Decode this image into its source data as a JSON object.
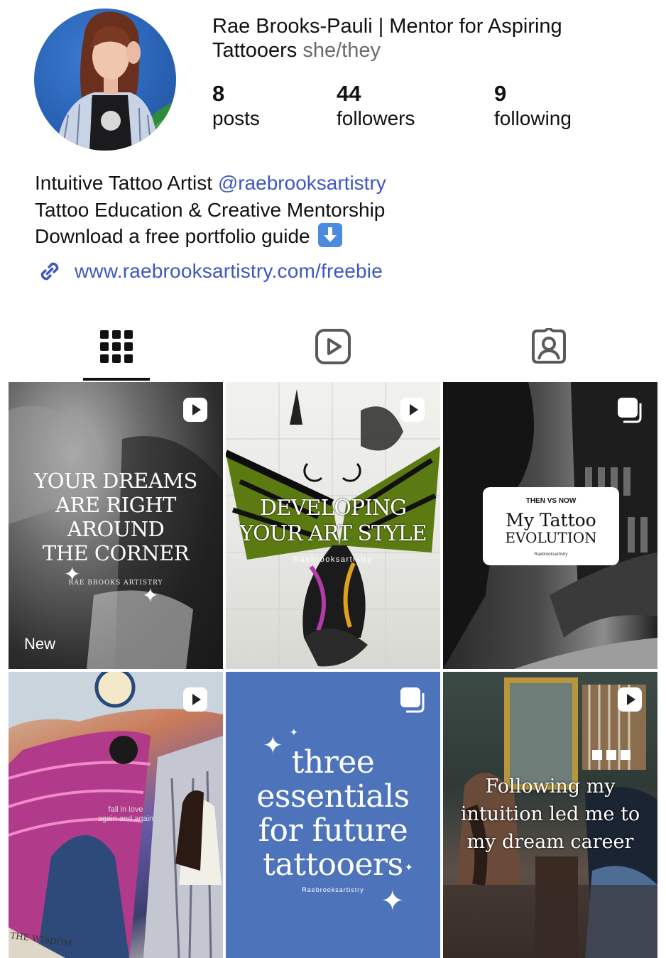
{
  "profile": {
    "name": "Rae Brooks-Pauli | Mentor for Aspiring Tattooers",
    "pronouns": "she/they",
    "stats": [
      {
        "value": "8",
        "label": "posts"
      },
      {
        "value": "44",
        "label": "followers"
      },
      {
        "value": "9",
        "label": "following"
      }
    ]
  },
  "bio": {
    "line1_text": "Intuitive Tattoo Artist ",
    "line1_mention": "@raebrooksartistry",
    "line2": "Tattoo Education & Creative Mentorship",
    "line3": "Download a free portfolio guide",
    "link": "www.raebrooksartistry.com/freebie"
  },
  "tabs": [
    {
      "icon": "grid-icon",
      "active": true
    },
    {
      "icon": "reels-icon",
      "active": false
    },
    {
      "icon": "tagged-icon",
      "active": false
    }
  ],
  "posts": [
    {
      "type": "reel",
      "text": [
        "YOUR DREAMS",
        "ARE RIGHT",
        "AROUND",
        "THE CORNER"
      ],
      "brand": "RAE BROOKS ARTISTRY",
      "label": "New"
    },
    {
      "type": "reel",
      "text": [
        "DEVELOPING",
        "YOUR ART STYLE"
      ],
      "brand": "Raebrooksartistry"
    },
    {
      "type": "carousel",
      "kicker": "THEN VS NOW",
      "text": [
        "My Tattoo",
        "EVOLUTION"
      ],
      "brand": "Raebrooksartistry"
    },
    {
      "type": "reel",
      "text": [
        "fall in love",
        "again and again"
      ],
      "corner_text": "THE WISDOM"
    },
    {
      "type": "carousel",
      "text": [
        "three",
        "essentials",
        "for future",
        "tattooers"
      ],
      "brand": "Raebrooksartistry"
    },
    {
      "type": "reel",
      "text": [
        "Following my",
        "intuition led me to",
        "my dream career"
      ]
    }
  ],
  "colors": {
    "link": "#3d57c4",
    "text": "#111111",
    "muted": "#6b6b6b",
    "tile5": "#4d74bb"
  }
}
